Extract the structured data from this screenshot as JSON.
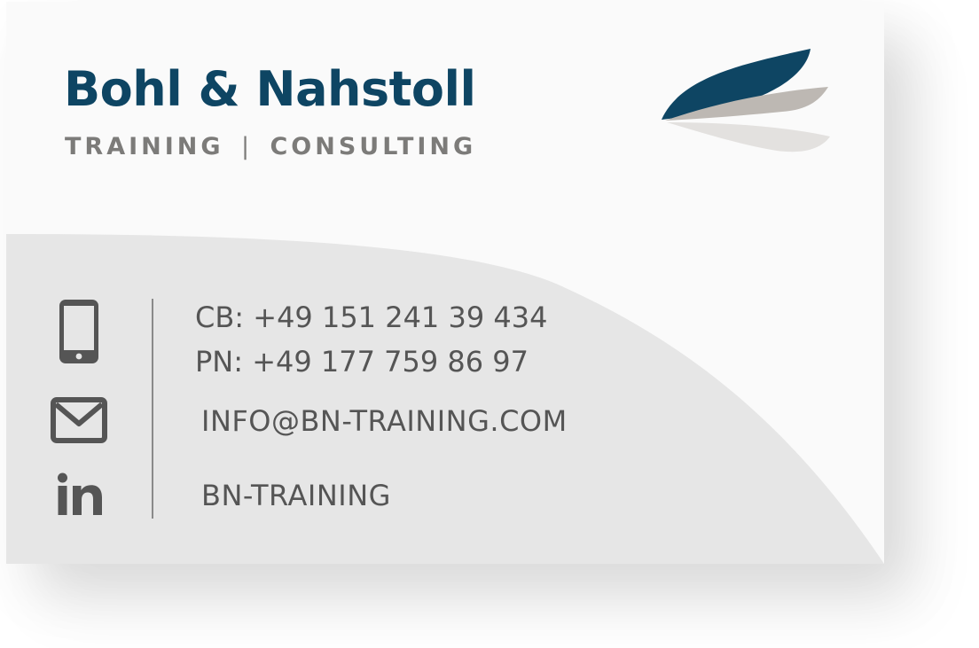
{
  "brand": {
    "name": "Bohl & Nahstoll",
    "tagline_left": "TRAINING",
    "tagline_separator": "|",
    "tagline_right": "CONSULTING"
  },
  "contact": {
    "phone_cb": "CB: +49 151 241 39 434",
    "phone_pn": "PN: +49 177 759 86 97",
    "email": "INFO@BN-TRAINING.COM",
    "linkedin": "BN-TRAINING"
  },
  "icons": {
    "phone": "smartphone-icon",
    "mail": "envelope-icon",
    "linkedin": "linkedin-icon",
    "logo": "feather-wing-logo"
  },
  "colors": {
    "brand_blue": "#0e4563",
    "tagline_gray": "#7c7b79",
    "text_gray": "#555555",
    "wing_gray": "#bdb8b3",
    "wing_light": "#e3e1df",
    "card_background": "#fafafa",
    "card_band": "#e6e6e6"
  }
}
